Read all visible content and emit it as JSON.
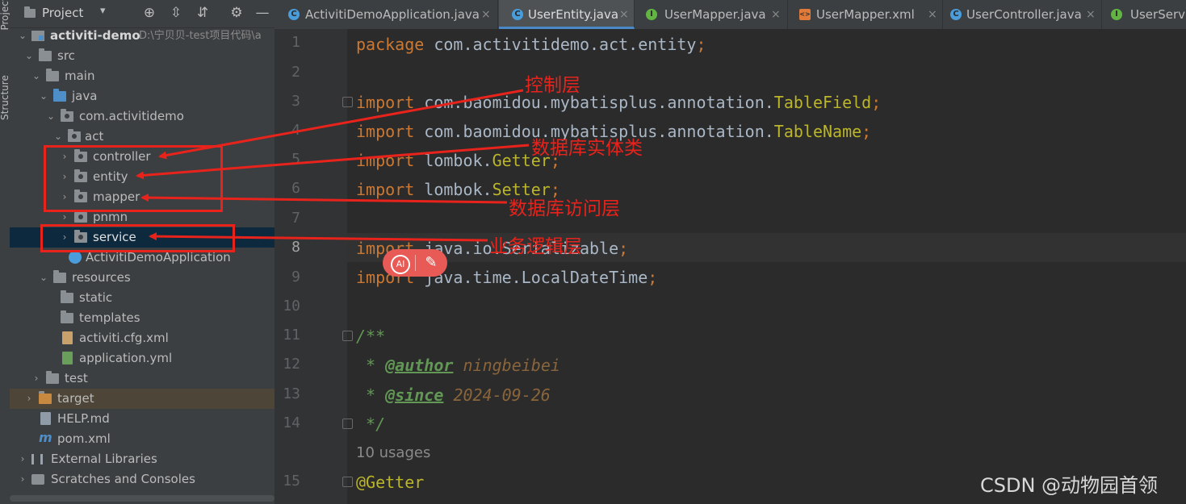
{
  "side_strip": {
    "project_label": "Project",
    "structure_label": "Structure"
  },
  "panel": {
    "title": "Project",
    "title_arrow": "▾",
    "icons": {
      "target": "crosshair-icon",
      "expand": "expand-all-icon",
      "collapse": "collapse-all-icon",
      "settings": "gear-icon",
      "hide": "minimize-icon"
    }
  },
  "tree": [
    {
      "label": "activiti-demo",
      "sub": "D:\\宁贝贝-test项目代码\\a",
      "icon": "module-icon",
      "expanded": true
    },
    {
      "label": "src",
      "icon": "folder-icon",
      "expanded": true
    },
    {
      "label": "main",
      "icon": "folder-icon",
      "expanded": true
    },
    {
      "label": "java",
      "icon": "source-folder-icon",
      "expanded": true
    },
    {
      "label": "com.activitidemo",
      "icon": "package-icon",
      "expanded": true
    },
    {
      "label": "act",
      "icon": "package-icon",
      "expanded": true
    },
    {
      "label": "controller",
      "icon": "package-icon",
      "expanded": false
    },
    {
      "label": "entity",
      "icon": "package-icon",
      "expanded": false
    },
    {
      "label": "mapper",
      "icon": "package-icon",
      "expanded": false
    },
    {
      "label": "pnmn",
      "icon": "package-icon",
      "expanded": false
    },
    {
      "label": "service",
      "icon": "package-icon",
      "expanded": false,
      "selected": true
    },
    {
      "label": "ActivitiDemoApplication",
      "icon": "spring-class-icon"
    },
    {
      "label": "resources",
      "icon": "resources-folder-icon",
      "expanded": true
    },
    {
      "label": "static",
      "icon": "folder-icon"
    },
    {
      "label": "templates",
      "icon": "folder-icon"
    },
    {
      "label": "activiti.cfg.xml",
      "icon": "xml-file-icon"
    },
    {
      "label": "application.yml",
      "icon": "yaml-file-icon"
    },
    {
      "label": "test",
      "icon": "folder-icon",
      "expanded": false
    },
    {
      "label": "target",
      "icon": "excluded-folder-icon",
      "expanded": false
    },
    {
      "label": "HELP.md",
      "icon": "markdown-file-icon"
    },
    {
      "label": "pom.xml",
      "icon": "maven-file-icon"
    },
    {
      "label": "External Libraries",
      "icon": "libraries-icon",
      "expanded": false
    },
    {
      "label": "Scratches and Consoles",
      "icon": "scratches-icon",
      "expanded": false
    }
  ],
  "tabs": [
    {
      "label": "ActivitiDemoApplication.java",
      "icon": "spring-class-icon",
      "color": "#4a9ddb",
      "glyph": "C"
    },
    {
      "label": "UserEntity.java",
      "icon": "class-icon",
      "color": "#4a9ddb",
      "glyph": "C",
      "active": true
    },
    {
      "label": "UserMapper.java",
      "icon": "interface-icon",
      "color": "#62b543",
      "glyph": "I"
    },
    {
      "label": "UserMapper.xml",
      "icon": "xml-file-icon",
      "color": "#e07b39",
      "glyph": "<>"
    },
    {
      "label": "UserController.java",
      "icon": "class-icon",
      "color": "#4a9ddb",
      "glyph": "C"
    },
    {
      "label": "UserServi",
      "icon": "interface-icon",
      "color": "#62b543",
      "glyph": "I"
    }
  ],
  "tab_close": "×",
  "code": {
    "line_numbers": [
      "1",
      "2",
      "3",
      "4",
      "5",
      "6",
      "7",
      "8",
      "9",
      "10",
      "11",
      "12",
      "13",
      "14",
      "15"
    ],
    "package_kw": "package",
    "package_name": "com.activitidemo.act.entity",
    "import_kw": "import",
    "imp3_pkg": "com.baomidou.mybatisplus.annotation.",
    "imp3_cls": "TableField",
    "imp4_pkg": "com.baomidou.mybatisplus.annotation.",
    "imp4_cls": "TableName",
    "imp5_pkg": "lombok.",
    "imp5_cls": "Getter",
    "imp6_pkg": "lombok.",
    "imp6_cls": "Setter",
    "imp8_rest": "java.io.Serializable",
    "imp9_rest": "java.time.LocalDateTime",
    "semicolon": ";",
    "doc_open": "/**",
    "doc_star": "*",
    "author_tag": "@author",
    "author_val": "ningbeibei",
    "since_tag": "@since",
    "since_val": "2024-09-26",
    "doc_close": "*/",
    "usages": "10 usages",
    "annotation": "@Getter"
  },
  "annotations": {
    "controller_label": "控制层",
    "entity_label": "数据库实体类",
    "mapper_label": "数据库访问层",
    "service_label": "业务逻辑层",
    "color": "#e8231c"
  },
  "ai_bubble": {
    "ai_label": "AI",
    "edit_icon": "magic-pen-icon"
  },
  "watermark": "CSDN @动物园首领"
}
